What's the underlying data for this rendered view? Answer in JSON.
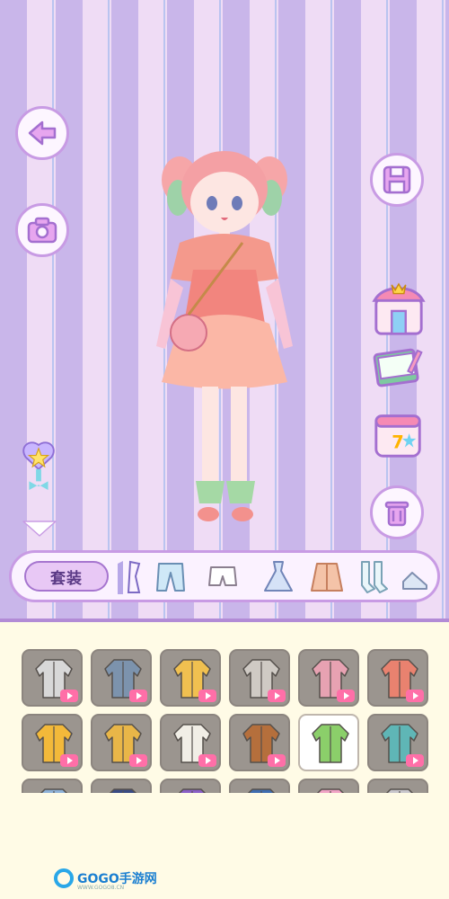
{
  "category_bar": {
    "outfit_label": "套装",
    "categories": [
      "outfit",
      "tops",
      "pants",
      "shorts",
      "dresses",
      "coats",
      "socks",
      "shoes"
    ]
  },
  "items": [
    {
      "icon": "plaid-shirt-icon",
      "ad": true,
      "selected": false
    },
    {
      "icon": "denim-jacket-icon",
      "ad": true,
      "selected": false
    },
    {
      "icon": "yellow-cardigan-icon",
      "ad": true,
      "selected": false
    },
    {
      "icon": "gray-coat-icon",
      "ad": true,
      "selected": false
    },
    {
      "icon": "pink-puffer-icon",
      "ad": true,
      "selected": false
    },
    {
      "icon": "red-hoodie-icon",
      "ad": true,
      "selected": false
    },
    {
      "icon": "yellow-hoodie-icon",
      "ad": true,
      "selected": false
    },
    {
      "icon": "yellow-cape-icon",
      "ad": true,
      "selected": false
    },
    {
      "icon": "white-uniform-icon",
      "ad": true,
      "selected": false
    },
    {
      "icon": "brown-jacket-icon",
      "ad": true,
      "selected": false
    },
    {
      "icon": "green-jacket-icon",
      "ad": false,
      "selected": true
    },
    {
      "icon": "teal-jacket-icon",
      "ad": true,
      "selected": false
    },
    {
      "icon": "blue-hoodie-icon",
      "ad": false,
      "selected": false
    },
    {
      "icon": "navy-jacket-icon",
      "ad": false,
      "selected": false
    },
    {
      "icon": "purple-top-icon",
      "ad": false,
      "selected": false
    },
    {
      "icon": "blue-coat-icon",
      "ad": false,
      "selected": false
    },
    {
      "icon": "pink-top-icon",
      "ad": false,
      "selected": false
    },
    {
      "icon": "gray-jacket-icon",
      "ad": false,
      "selected": false
    }
  ],
  "watermark": {
    "brand": "GOGO手游网",
    "url": "WWW.GOGO8.CN"
  },
  "colors": {
    "accent": "#c89be4",
    "panel": "#fffbe6",
    "ad_badge": "#ff6fa8"
  }
}
